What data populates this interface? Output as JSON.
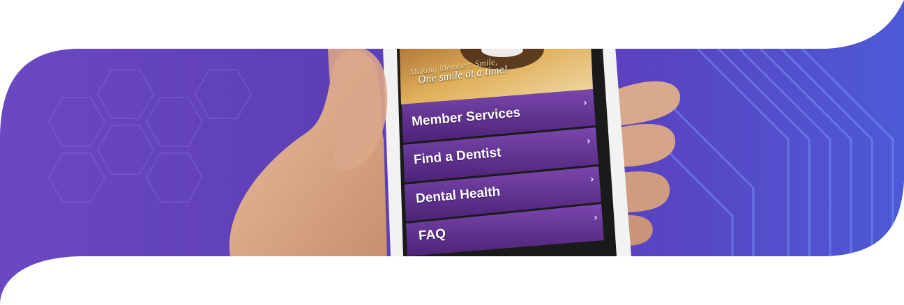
{
  "hero": {
    "tagline_line1": "Making Members Smile,",
    "tagline_line2": "One smile at a time!"
  },
  "menu": {
    "items": [
      {
        "label": "Member Services",
        "icon": "chevron-right-icon"
      },
      {
        "label": "Find a Dentist",
        "icon": "chevron-right-icon"
      },
      {
        "label": "Dental Health",
        "icon": "chevron-right-icon"
      },
      {
        "label": "FAQ",
        "icon": "chevron-right-icon"
      }
    ],
    "chevron_glyph": "›"
  },
  "colors": {
    "banner_purple": "#6a4bc4",
    "menu_purple": "#5b2c86",
    "white": "#ffffff"
  }
}
